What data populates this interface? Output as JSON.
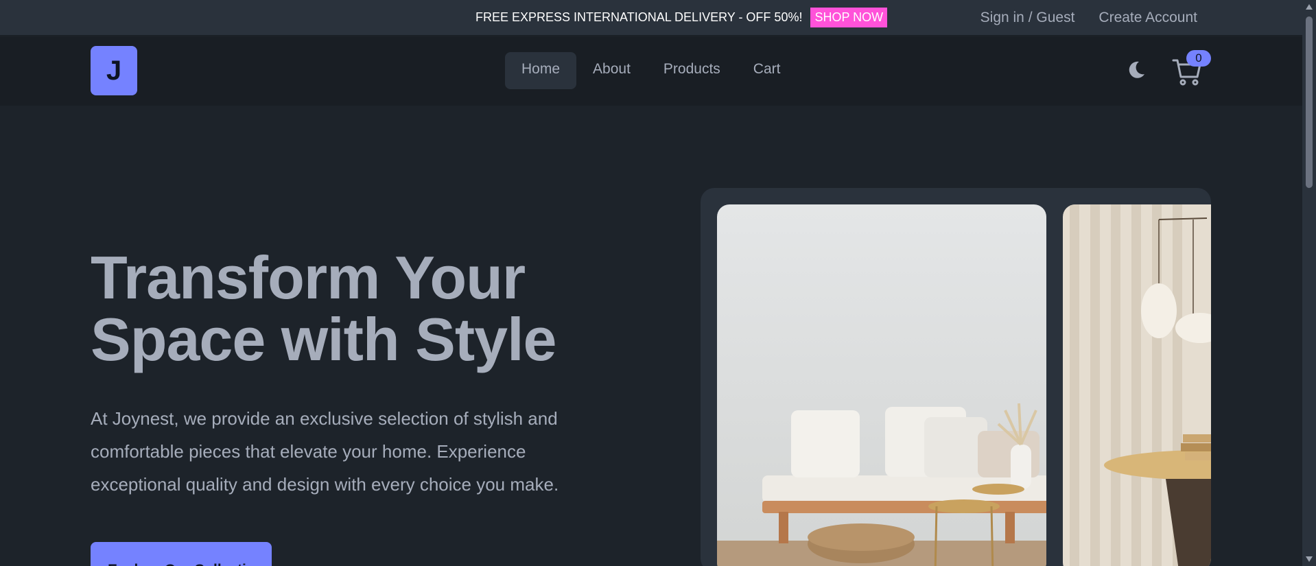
{
  "topbar": {
    "promo_text": "FREE EXPRESS INTERNATIONAL DELIVERY - OFF 50%!",
    "promo_button": "SHOP NOW",
    "sign_in": "Sign in / Guest",
    "create_account": "Create Account"
  },
  "nav": {
    "logo_letter": "J",
    "items": [
      {
        "label": "Home",
        "active": true
      },
      {
        "label": "About"
      },
      {
        "label": "Products"
      },
      {
        "label": "Cart"
      }
    ],
    "theme_icon": "moon-icon",
    "cart_icon": "cart-icon",
    "cart_count": "0"
  },
  "hero": {
    "title_line1": "Transform Your",
    "title_line2": "Space with Style",
    "description": "At Joynest, we provide an exclusive selection of stylish and comfortable pieces that elevate your home. Experience exceptional quality and design with every choice you make.",
    "cta": "Explore Our Collection"
  },
  "colors": {
    "background": "#1d232a",
    "topbar": "#2a323c",
    "navbar": "#191e24",
    "primary": "#7582ff",
    "promo_accent": "#ff52d9",
    "text": "#a6adbb"
  }
}
